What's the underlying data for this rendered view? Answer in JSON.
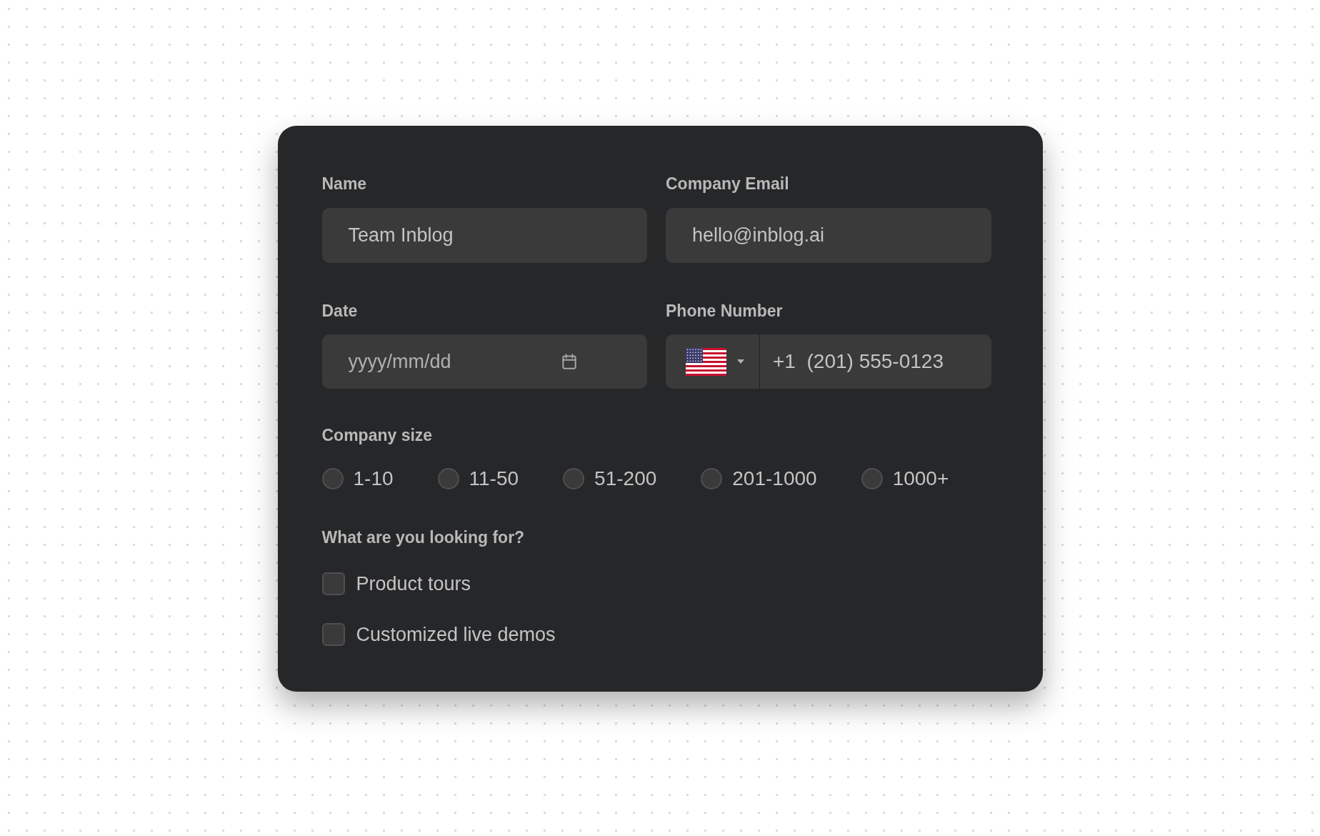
{
  "fields": [
    {
      "kind": "text",
      "label": "Name",
      "value": "Team Inblog"
    },
    {
      "kind": "text",
      "label": "Company Email",
      "value": "hello@inblog.ai"
    },
    {
      "kind": "date",
      "label": "Date",
      "placeholder": "yyyy/mm/dd"
    },
    {
      "kind": "phone",
      "label": "Phone Number",
      "value": "+1  (201) 555-0123"
    }
  ],
  "company_size": {
    "label": "Company size",
    "options": [
      {
        "label": "1-10",
        "selected": false
      },
      {
        "label": "11-50",
        "selected": false
      },
      {
        "label": "51-200",
        "selected": false
      },
      {
        "label": "201-1000",
        "selected": false
      },
      {
        "label": "1000+",
        "selected": false
      }
    ]
  },
  "looking_for": {
    "label": "What are you looking for?",
    "options": [
      {
        "label": "Product tours",
        "checked": false
      },
      {
        "label": "Customized live demos",
        "checked": false
      }
    ]
  }
}
